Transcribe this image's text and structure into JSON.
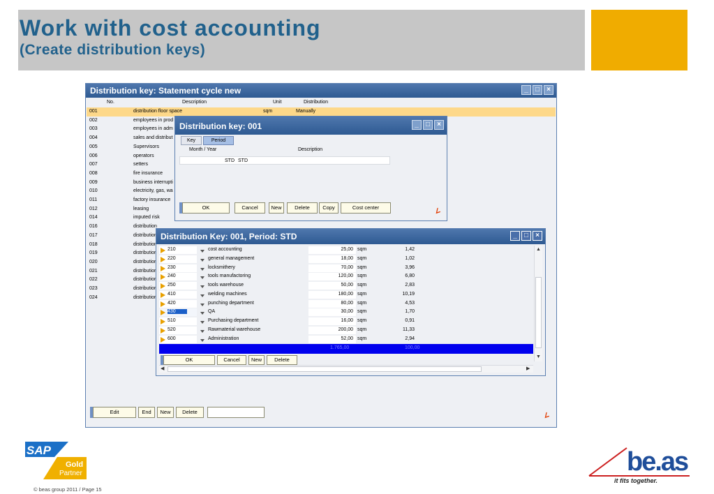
{
  "slide": {
    "title": "Work with cost accounting",
    "subtitle": "(Create distribution keys)",
    "footer": "© beas group 2011 / Page 15",
    "sap_logo": {
      "brand": "SAP",
      "line1": "Gold",
      "line2": "Partner"
    },
    "beas_logo": {
      "brand": "be.as",
      "tagline": "it fits together."
    }
  },
  "colors": {
    "title": "#21618c",
    "accent": "#f0ac00",
    "highlight_row": "#fdd889",
    "total_row": "#0000ee",
    "selected_cell": "#1a5fc8"
  },
  "main_window": {
    "title": "Distribution key: Statement cycle new",
    "columns": [
      "No.",
      "Description",
      "Unit",
      "Distribution"
    ],
    "rows": [
      {
        "no": "001",
        "desc": "distribution floor space",
        "unit": "sqm",
        "dist": "Manually"
      },
      {
        "no": "002",
        "desc": "employees in prod",
        "unit": "",
        "dist": ""
      },
      {
        "no": "003",
        "desc": "employees in adm",
        "unit": "",
        "dist": ""
      },
      {
        "no": "004",
        "desc": "sales and distribut",
        "unit": "",
        "dist": ""
      },
      {
        "no": "005",
        "desc": "Supervisors",
        "unit": "",
        "dist": ""
      },
      {
        "no": "006",
        "desc": "operators",
        "unit": "",
        "dist": ""
      },
      {
        "no": "007",
        "desc": "setters",
        "unit": "",
        "dist": ""
      },
      {
        "no": "008",
        "desc": "fire insurance",
        "unit": "",
        "dist": ""
      },
      {
        "no": "009",
        "desc": "business interrupti",
        "unit": "",
        "dist": ""
      },
      {
        "no": "010",
        "desc": "electricity, gas, wa",
        "unit": "",
        "dist": ""
      },
      {
        "no": "011",
        "desc": "factory insurance",
        "unit": "",
        "dist": ""
      },
      {
        "no": "012",
        "desc": "leasing",
        "unit": "",
        "dist": ""
      },
      {
        "no": "014",
        "desc": "imputed risk",
        "unit": "",
        "dist": ""
      },
      {
        "no": "016",
        "desc": "distribution",
        "unit": "",
        "dist": ""
      },
      {
        "no": "017",
        "desc": "distribution",
        "unit": "",
        "dist": ""
      },
      {
        "no": "018",
        "desc": "distribution",
        "unit": "",
        "dist": ""
      },
      {
        "no": "019",
        "desc": "distribution",
        "unit": "",
        "dist": ""
      },
      {
        "no": "020",
        "desc": "distribution",
        "unit": "",
        "dist": ""
      },
      {
        "no": "021",
        "desc": "distribution",
        "unit": "",
        "dist": ""
      },
      {
        "no": "022",
        "desc": "distribution",
        "unit": "",
        "dist": ""
      },
      {
        "no": "023",
        "desc": "distribution",
        "unit": "",
        "dist": ""
      },
      {
        "no": "024",
        "desc": "distribution",
        "unit": "",
        "dist": ""
      }
    ],
    "buttons": {
      "edit": "Edit",
      "end": "End",
      "new": "New",
      "delete": "Delete"
    },
    "search_value": ""
  },
  "dk_window": {
    "title": "Distribution key: 001",
    "tabs": [
      "Key",
      "Period"
    ],
    "columns": [
      "Month / Year",
      "Description"
    ],
    "row": {
      "month": "STD",
      "desc": "STD"
    },
    "buttons": {
      "ok": "OK",
      "cancel": "Cancel",
      "new": "New",
      "delete": "Delete",
      "copy": "Copy",
      "cost_center": "Cost center"
    }
  },
  "dist_window": {
    "title": "Distribution Key: 001,  Period: STD",
    "rows": [
      {
        "cc": "210",
        "desc": "cost accounting",
        "qty": "25,00",
        "unit": "sqm",
        "pct": "1,42"
      },
      {
        "cc": "220",
        "desc": "general management",
        "qty": "18,00",
        "unit": "sqm",
        "pct": "1,02"
      },
      {
        "cc": "230",
        "desc": "locksmithery",
        "qty": "70,00",
        "unit": "sqm",
        "pct": "3,96"
      },
      {
        "cc": "240",
        "desc": "tools manufactoring",
        "qty": "120,00",
        "unit": "sqm",
        "pct": "6,80"
      },
      {
        "cc": "250",
        "desc": "tools warehouse",
        "qty": "50,00",
        "unit": "sqm",
        "pct": "2,83"
      },
      {
        "cc": "410",
        "desc": "welding machines",
        "qty": "180,00",
        "unit": "sqm",
        "pct": "10,19"
      },
      {
        "cc": "420",
        "desc": "punching department",
        "qty": "80,00",
        "unit": "sqm",
        "pct": "4,53"
      },
      {
        "cc": "430",
        "desc": "QA",
        "qty": "30,00",
        "unit": "sqm",
        "pct": "1,70"
      },
      {
        "cc": "510",
        "desc": "Purchasing department",
        "qty": "16,00",
        "unit": "sqm",
        "pct": "0,91"
      },
      {
        "cc": "520",
        "desc": "Rawmaterial warehouse",
        "qty": "200,00",
        "unit": "sqm",
        "pct": "11,33"
      },
      {
        "cc": "600",
        "desc": "Administration",
        "qty": "52,00",
        "unit": "sqm",
        "pct": "2,94"
      }
    ],
    "total_qty": "1.765,00",
    "total_pct": "100,00",
    "buttons": {
      "ok": "OK",
      "cancel": "Cancel",
      "new": "New",
      "delete": "Delete"
    }
  }
}
